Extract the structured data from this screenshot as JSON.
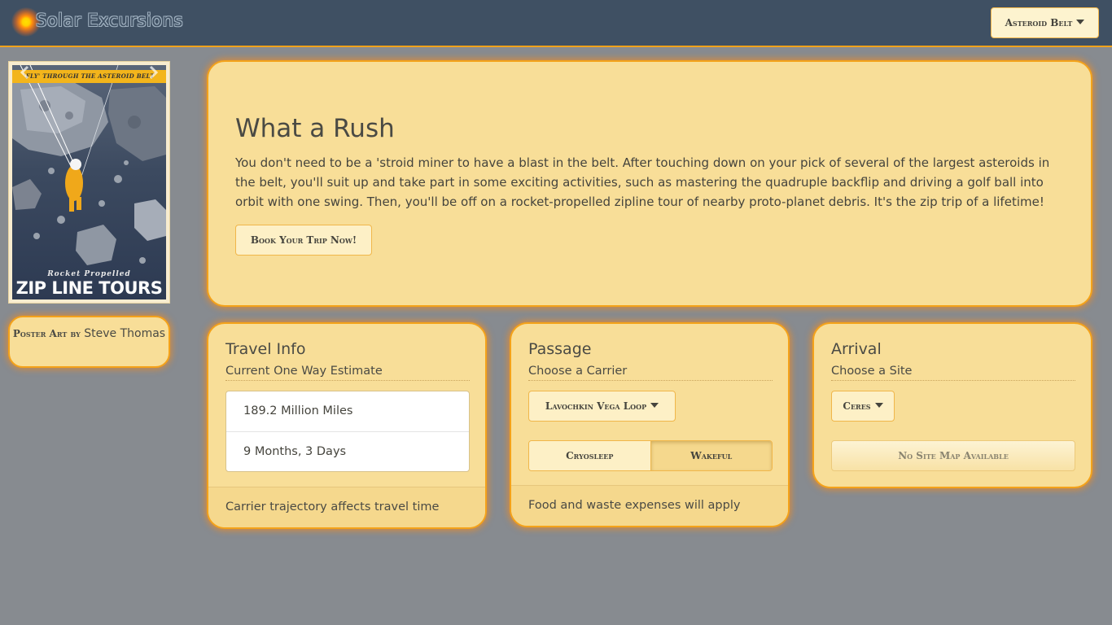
{
  "navbar": {
    "brand": "Solar Excursions",
    "destination_label": "Asteroid Belt"
  },
  "poster": {
    "banner": "'FLY' THROUGH THE ASTEROID BELT",
    "subtitle": "Rocket Propelled",
    "title": "ZIP LINE TOURS",
    "credit_label": "Poster Art by",
    "credit_name": "Steve Thomas"
  },
  "hero": {
    "title": "What a Rush",
    "text": "You don't need to be a 'stroid miner to have a blast in the belt. After touching down on your pick of several of the largest asteroids in the belt, you'll suit up and take part in some exciting activities, such as mastering the quadruple backflip and driving a golf ball into orbit with one swing. Then, you'll be off on a rocket-propelled zipline tour of nearby proto-planet debris. It's the zip trip of a lifetime!",
    "button": "Book Your Trip Now!"
  },
  "travel": {
    "title": "Travel Info",
    "subtitle": "Current One Way Estimate",
    "items": [
      "189.2 Million Miles",
      "9 Months, 3 Days"
    ],
    "footer": "Carrier trajectory affects travel time"
  },
  "passage": {
    "title": "Passage",
    "subtitle": "Choose a Carrier",
    "carrier": "Lavochkin Vega Loop",
    "options": [
      "Cryosleep",
      "Wakeful"
    ],
    "selected": "Wakeful",
    "footer": "Food and waste expenses will apply"
  },
  "arrival": {
    "title": "Arrival",
    "subtitle": "Choose a Site",
    "site": "Ceres",
    "map_button": "No Site Map Available"
  }
}
